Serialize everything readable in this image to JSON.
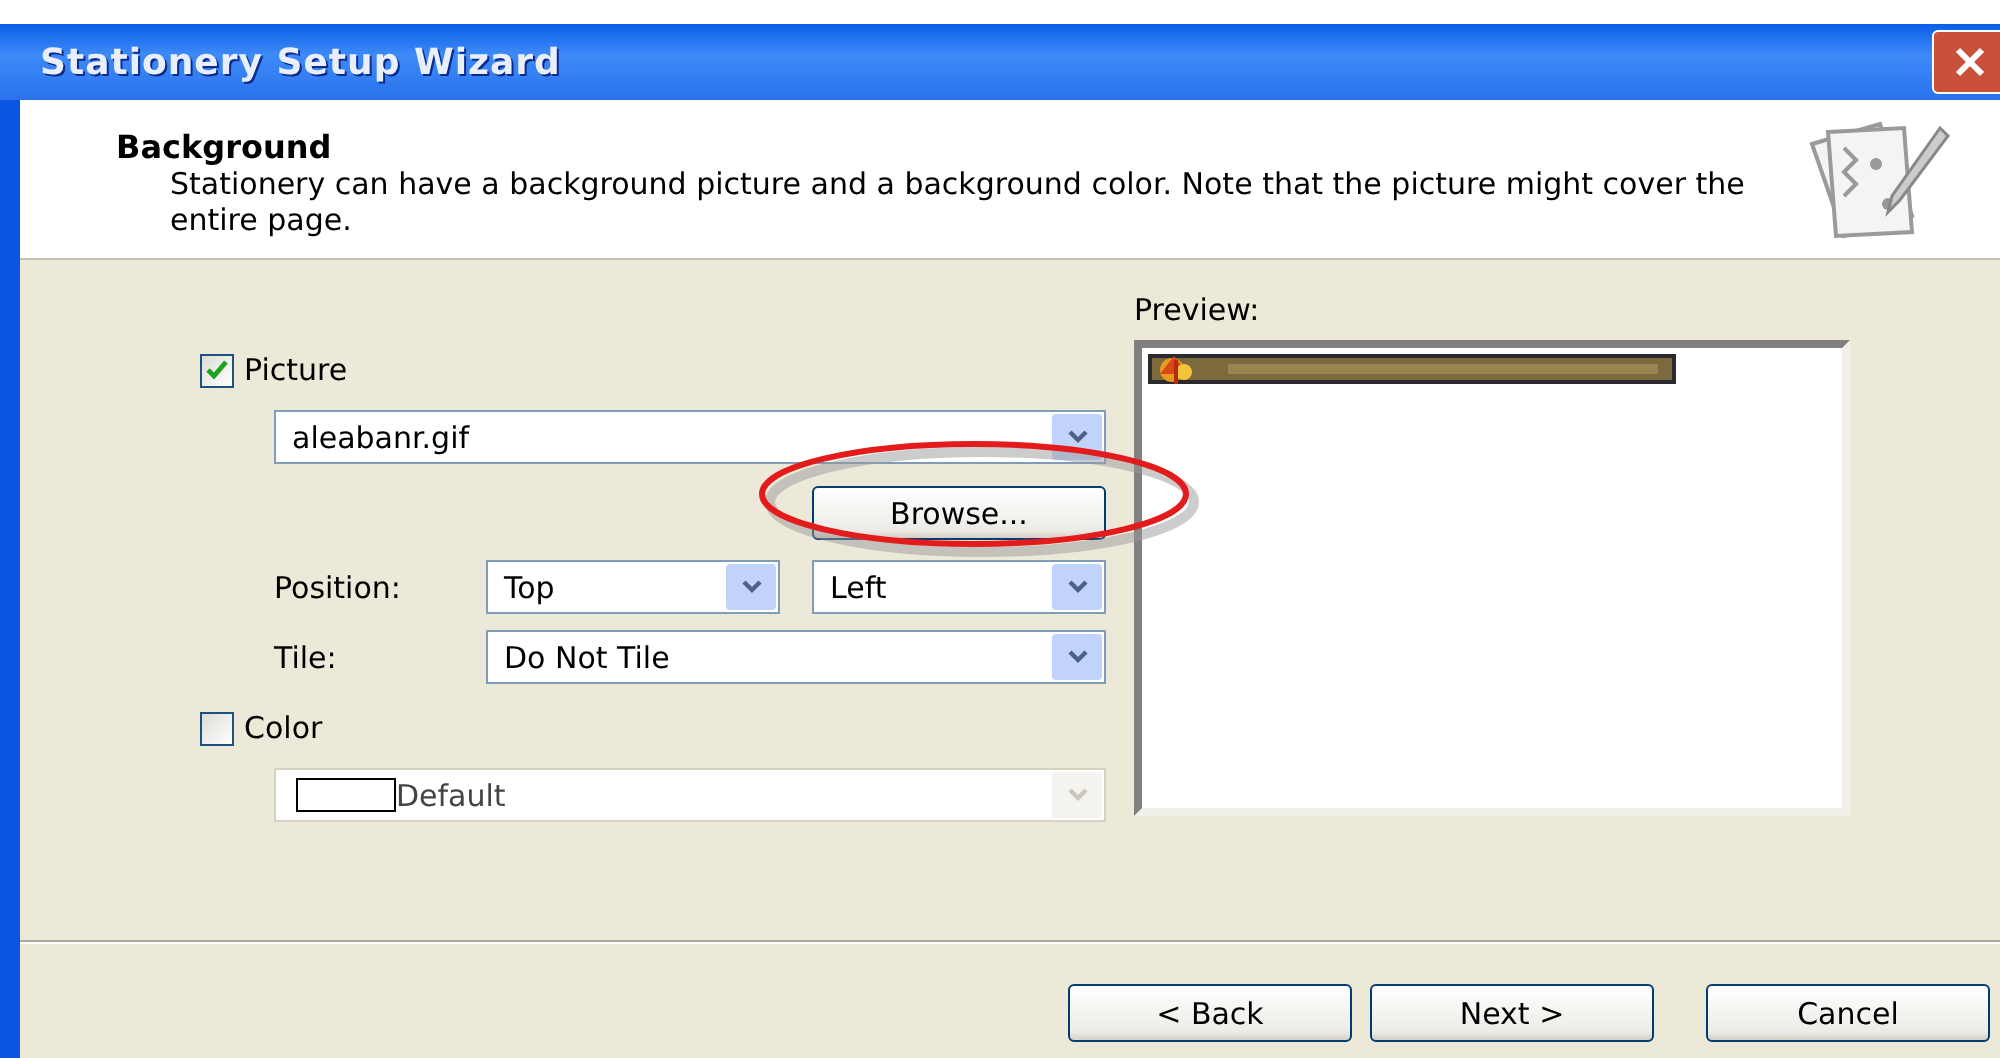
{
  "window": {
    "title": "Stationery Setup Wizard"
  },
  "header": {
    "title": "Background",
    "description": "Stationery can have a background picture and a background color. Note that the picture might cover the entire page."
  },
  "picture": {
    "label": "Picture",
    "checked": true,
    "file": "aleabanr.gif",
    "browse": "Browse...",
    "position_label": "Position:",
    "vertical": "Top",
    "horizontal": "Left",
    "tile_label": "Tile:",
    "tile": "Do Not Tile"
  },
  "color": {
    "label": "Color",
    "checked": false,
    "value": "Default",
    "disabled": true
  },
  "preview": {
    "label": "Preview:"
  },
  "buttons": [
    {
      "label": "< Back"
    },
    {
      "label": "Next >"
    },
    {
      "label": "Cancel"
    }
  ]
}
